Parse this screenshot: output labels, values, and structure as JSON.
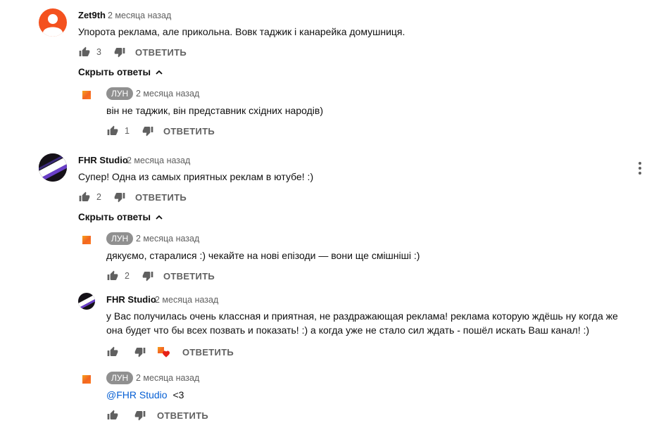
{
  "comments": [
    {
      "author": "Zet9th",
      "time": "2 месяца назад",
      "text": "Упорота реклама, але прикольна. Вовк таджик і канарейка домушниця.",
      "likes": "3",
      "reply_label": "ОТВЕТИТЬ",
      "hide_replies_label": "Скрыть ответы",
      "avatar_icon": "default-user-icon",
      "replies": [
        {
          "author": "ЛУН",
          "time": "2 месяца назад",
          "text": "він не таджик, він представник східних народів)",
          "likes": "1",
          "reply_label": "ОТВЕТИТЬ"
        }
      ]
    },
    {
      "author": "FHR Studio",
      "time": "2 месяца назад",
      "text": "Супер! Одна из самых приятных реклам в ютубе! :)",
      "likes": "2",
      "reply_label": "ОТВЕТИТЬ",
      "hide_replies_label": "Скрыть ответы",
      "avatar_text": "FHR STUDIO",
      "replies": [
        {
          "author": "ЛУН",
          "time": "2 месяца назад",
          "text": "дякуємо, старалися :) чекайте на нові епізоди — вони ще смішніші :)",
          "likes": "2",
          "reply_label": "ОТВЕТИТЬ"
        },
        {
          "author": "FHR Studio",
          "time": "2 месяца назад",
          "text": "у Вас получилась очень классная и приятная, не раздражающая реклама! реклама которую ждёшь ну когда же она будет что бы всех позвать и показать! :) а когда уже не стало сил ждать - пошёл искать Ваш канал! :)",
          "likes": "",
          "reply_label": "ОТВЕТИТЬ"
        },
        {
          "author": "ЛУН",
          "time": "2 месяца назад",
          "mention": "@FHR Studio",
          "text": "<3",
          "likes": "",
          "reply_label": "ОТВЕТИТЬ"
        }
      ]
    }
  ],
  "colors": {
    "creator_badge": "#909090",
    "link": "#065fd4",
    "secondary_text": "#606060",
    "heart": "#e62117",
    "default_avatar": "#f4511e"
  }
}
